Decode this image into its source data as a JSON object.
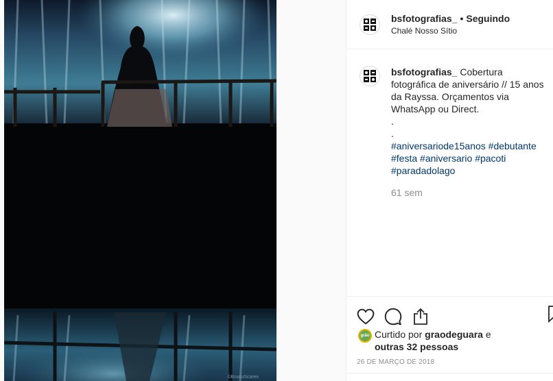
{
  "post": {
    "username": "bsfotografias_",
    "separator": "•",
    "follow_status": "Seguindo",
    "location": "Chalé Nosso Sítio",
    "caption_user": "bsfotografias_",
    "caption_text": "Cobertura fotográfica de aniversário // 15 anos da Rayssa. Orçamentos via WhatsApp ou Direct.",
    "caption_dot1": ".",
    "caption_dot2": ".",
    "hashtags": [
      "#aniversariode15anos",
      "#debutante",
      "#festa",
      "#aniversario",
      "#pacoti",
      "#paradadolago"
    ],
    "time_ago": "61 sem",
    "liked_by_prefix": "Curtido por",
    "liked_by_user": "graodeguara",
    "liked_by_and": "e",
    "liked_by_others": "outras 32 pessoas",
    "date": "26 DE MARÇO DE 2018",
    "photo_watermark": "©BrunoScares",
    "like_avatar_text": "grão"
  },
  "icons": {
    "like": "heart-icon",
    "comment": "comment-icon",
    "share": "share-icon",
    "save": "bookmark-icon"
  },
  "colors": {
    "hashtag": "#00376b",
    "secondary_text": "#8e8e8e",
    "border": "#efefef"
  }
}
